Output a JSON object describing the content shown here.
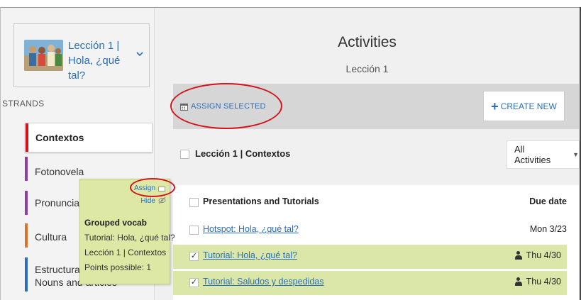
{
  "lesson": {
    "title": "Lección 1 | Hola, ¿qué tal?"
  },
  "sidebar": {
    "section_label": "STRANDS",
    "strands": [
      {
        "label": "Contextos",
        "color": "#d4121a",
        "active": true
      },
      {
        "label": "Fotonovela",
        "color": "#8b3fa1"
      },
      {
        "label": "Pronunciación",
        "color": "#8b3fa1"
      },
      {
        "label": "Cultura",
        "color": "#d9752b"
      },
      {
        "label": "Estructura 1.1",
        "sublabel": "Nouns and articles",
        "color": "#2a6ebb"
      }
    ]
  },
  "header": {
    "title": "Activities",
    "subtitle": "Lección 1"
  },
  "toolbar": {
    "assign_label": "ASSIGN SELECTED",
    "create_label": "CREATE NEW"
  },
  "filter": {
    "row_label": "Lección 1 | Contextos",
    "selected": "All Activities"
  },
  "table": {
    "header": {
      "name": "Presentations and Tutorials",
      "date": "Due date"
    },
    "rows": [
      {
        "name": "Hotspot: Hola, ¿qué tal?",
        "date": "Mon 3/23",
        "checked": false,
        "assigned": false
      },
      {
        "name": "Tutorial: Hola, ¿qué tal?",
        "date": "Thu 4/30",
        "checked": true,
        "assigned": true
      },
      {
        "name": "Tutorial: Saludos y despedidas",
        "date": "Thu 4/30",
        "checked": true,
        "assigned": true
      }
    ]
  },
  "popup": {
    "assign_label": "Assign",
    "hide_label": "Hide",
    "title": "Grouped vocab",
    "line1": "Tutorial: Hola, ¿qué tal?",
    "line2": "Lección 1 | Contextos",
    "line3": "Points possible: 1"
  },
  "colors": {
    "accent": "#2a6ebb",
    "highlight_row": "#dbe7a8",
    "annotation": "#d4121a"
  }
}
